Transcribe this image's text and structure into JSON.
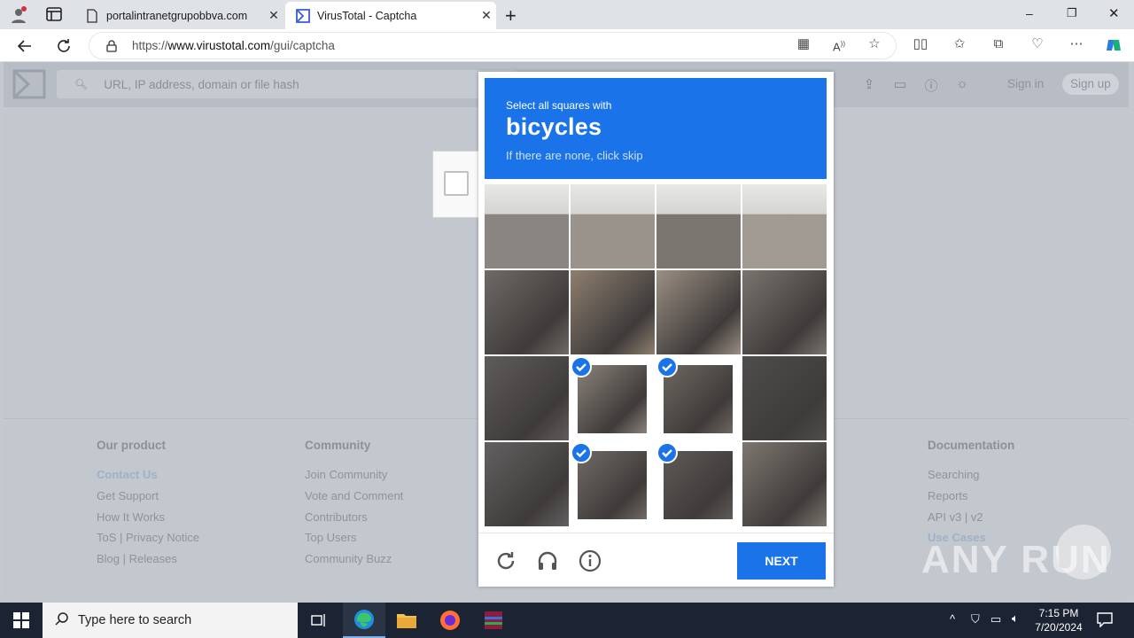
{
  "browser": {
    "tabs": [
      {
        "title": "portalintranetgrupobbva.com",
        "active": false
      },
      {
        "title": "VirusTotal - Captcha",
        "active": true
      }
    ],
    "url_prefix": "https://",
    "url_domain": "www.virustotal.com",
    "url_path": "/gui/captcha",
    "window_controls": {
      "minimize": "–",
      "restore": "❐",
      "close": "✕"
    }
  },
  "virustotal": {
    "search_placeholder": "URL, IP address, domain or file hash",
    "sign_in": "Sign in",
    "sign_up": "Sign up",
    "footer": {
      "our_product": {
        "heading": "Our product",
        "links": [
          "Contact Us",
          "Get Support",
          "How It Works",
          "ToS | Privacy Notice",
          "Blog | Releases"
        ]
      },
      "community": {
        "heading": "Community",
        "links": [
          "Join Community",
          "Vote and Comment",
          "Contributors",
          "Top Users",
          "Community Buzz"
        ]
      },
      "documentation": {
        "heading": "Documentation",
        "links": [
          "Searching",
          "Reports",
          "API v3 | v2",
          "Use Cases"
        ]
      }
    }
  },
  "captcha": {
    "instruction": "Select all squares with",
    "target": "bicycles",
    "hint": "If there are none, click skip",
    "selected_tiles": [
      9,
      10,
      13,
      14
    ],
    "next_label": "NEXT"
  },
  "watermark": "ANY RUN",
  "taskbar": {
    "search_placeholder": "Type here to search",
    "time": "7:15 PM",
    "date": "7/20/2024"
  },
  "colors": {
    "accent": "#1a73e8",
    "taskbar": "#1c2433"
  }
}
